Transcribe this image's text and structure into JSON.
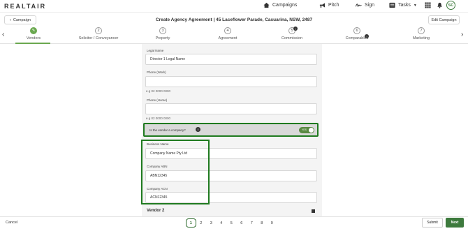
{
  "app": {
    "logo": "REALTAIR"
  },
  "nav": {
    "campaigns": "Campaigns",
    "pitch": "Pitch",
    "sign": "Sign",
    "tasks": "Tasks",
    "avatar": "SC"
  },
  "header": {
    "back_label": "Campaign",
    "title": "Create Agency Agreement | 45 Laceflower Parade, Casuarina, NSW, 2487",
    "edit_label": "Edit Campaign"
  },
  "steps": [
    {
      "num": "",
      "label": "Vendors",
      "state": "done"
    },
    {
      "num": "2",
      "label": "Solicitor / Conveyancer",
      "state": "todo"
    },
    {
      "num": "3",
      "label": "Property",
      "state": "todo"
    },
    {
      "num": "4",
      "label": "Agreement",
      "state": "todo"
    },
    {
      "num": "5",
      "label": "Commission",
      "state": "warn"
    },
    {
      "num": "6",
      "label": "Comparables",
      "state": "warn"
    },
    {
      "num": "7",
      "label": "Marketing",
      "state": "todo"
    }
  ],
  "form": {
    "legal_name_label": "Legal Name",
    "legal_name_value": "Director 1 Legal Name",
    "phone_work_label": "Phone (Work)",
    "phone_work_value": "",
    "phone_work_hint": "e.g 02 0000 0000",
    "phone_home_label": "Phone (Home)",
    "phone_home_value": "",
    "phone_home_hint": "e.g 02 0000 0000",
    "company_question": "Is the vendor a company?",
    "company_toggle": "YES",
    "business_name_label": "Business Name",
    "business_name_value": "Company Name Pty Ltd",
    "abn_label": "Company ABN",
    "abn_value": "ABN12345",
    "acn_label": "Company ACN",
    "acn_value": "ACN12345",
    "vendor2_label": "Vendor 2"
  },
  "footer": {
    "cancel": "Cancel",
    "pages": [
      "1",
      "2",
      "3",
      "4",
      "5",
      "6",
      "7",
      "8",
      "9"
    ],
    "active_page": "1",
    "submit": "Submit",
    "next": "Next"
  },
  "colors": {
    "accent": "#3d7a3d",
    "highlight_border": "#1f7a1f"
  }
}
